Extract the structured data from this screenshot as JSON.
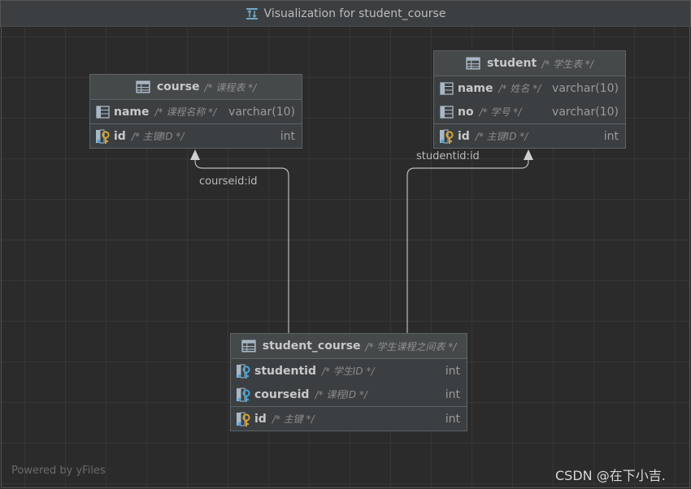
{
  "window": {
    "title": "Visualization for student_course",
    "icon": "diagram-icon"
  },
  "tables": {
    "course": {
      "name": "course",
      "comment": "/* 课程表 */",
      "columns": [
        {
          "name": "name",
          "comment": "/* 课程名称 */",
          "type": "varchar(10)",
          "key": "column"
        }
      ],
      "pk": {
        "name": "id",
        "comment": "/* 主键ID */",
        "type": "int",
        "key": "primary"
      }
    },
    "student": {
      "name": "student",
      "comment": "/* 学生表 */",
      "columns": [
        {
          "name": "name",
          "comment": "/* 姓名 */",
          "type": "varchar(10)",
          "key": "column"
        },
        {
          "name": "no",
          "comment": "/* 学号 */",
          "type": "varchar(10)",
          "key": "column"
        }
      ],
      "pk": {
        "name": "id",
        "comment": "/* 主键ID */",
        "type": "int",
        "key": "primary"
      }
    },
    "student_course": {
      "name": "student_course",
      "comment": "/* 学生课程之间表 */",
      "columns": [
        {
          "name": "studentid",
          "comment": "/* 学生ID */",
          "type": "int",
          "key": "foreign"
        },
        {
          "name": "courseid",
          "comment": "/* 课程ID */",
          "type": "int",
          "key": "foreign"
        }
      ],
      "pk": {
        "name": "id",
        "comment": "/* 主键 */",
        "type": "int",
        "key": "primary"
      }
    }
  },
  "relations": {
    "course_link": "courseid:id",
    "student_link": "studentid:id"
  },
  "footer": {
    "powered_by": "Powered by yFiles",
    "watermark": "CSDN @在下小吉."
  },
  "colors": {
    "primary_key": "#d6a333",
    "foreign_key": "#4aa3d4",
    "edge": "#bbbbbb"
  }
}
